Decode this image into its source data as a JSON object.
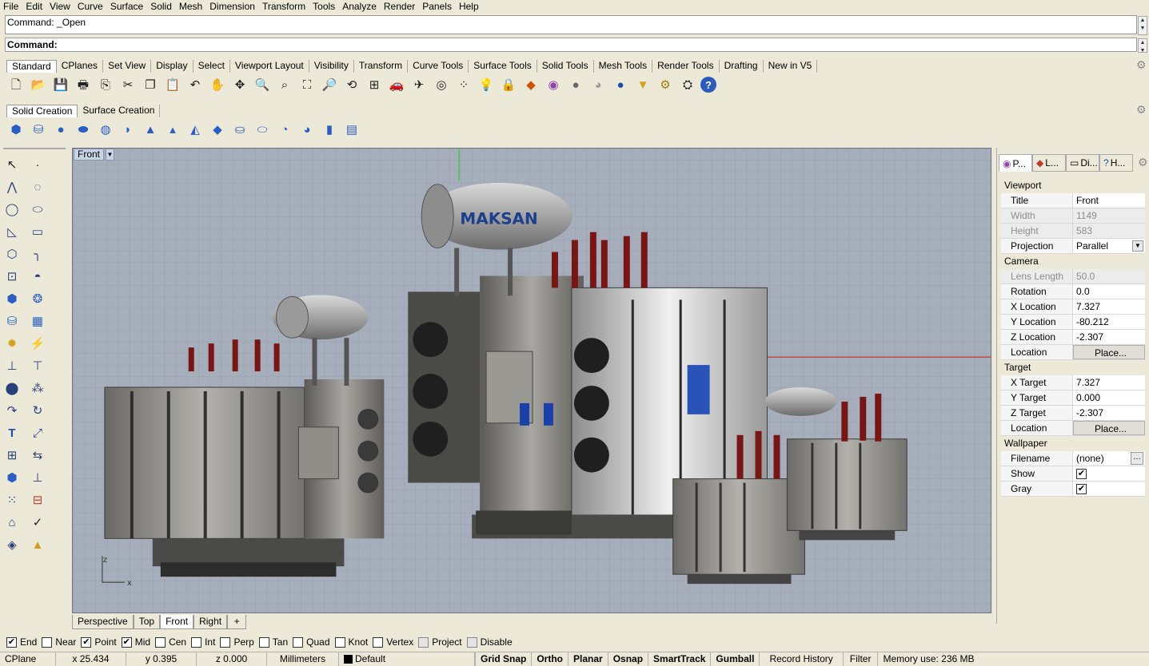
{
  "menu": [
    "File",
    "Edit",
    "View",
    "Curve",
    "Surface",
    "Solid",
    "Mesh",
    "Dimension",
    "Transform",
    "Tools",
    "Analyze",
    "Render",
    "Panels",
    "Help"
  ],
  "command": {
    "history": "Command: _Open",
    "prompt": "Command:"
  },
  "toolbar_tabs": [
    "Standard",
    "CPlanes",
    "Set View",
    "Display",
    "Select",
    "Viewport Layout",
    "Visibility",
    "Transform",
    "Curve Tools",
    "Surface Tools",
    "Solid Tools",
    "Mesh Tools",
    "Render Tools",
    "Drafting",
    "New in V5"
  ],
  "standard_icons": [
    "new-icon",
    "open-icon",
    "save-icon",
    "print-icon",
    "import-icon",
    "cut-icon",
    "copy-icon",
    "paste-icon",
    "undo-icon",
    "pan-icon",
    "rotate-view-icon",
    "zoom-icon",
    "zoom-window-icon",
    "zoom-extents-icon",
    "zoom-selected-icon",
    "rotate-icon",
    "four-views-icon",
    "car-icon",
    "plane-icon",
    "circle-target-icon",
    "point-grid-icon",
    "light-bulb-icon",
    "lock-icon",
    "layer-icon",
    "color-wheel-icon",
    "sphere-gray-icon",
    "sphere-shaded-icon",
    "sphere-blue-icon",
    "light-icon",
    "gear-wheel-icon",
    "options-icon",
    "help-icon"
  ],
  "solid_tabs": [
    "Solid Creation",
    "Surface Creation"
  ],
  "solid_icons": [
    "box-icon",
    "cylinder-icon",
    "sphere-icon",
    "ellipsoid-icon",
    "torus-icon",
    "cone-icon",
    "truncated-cone-icon",
    "pyramid-icon",
    "truncated-pyramid-icon",
    "tube-icon",
    "pipe-icon",
    "torus-knot-icon",
    "ring-icon",
    "extrude-icon",
    "slab-icon"
  ],
  "viewport": {
    "title": "Front",
    "tabs": [
      "Perspective",
      "Top",
      "Front",
      "Right"
    ],
    "brand_text": "MAKSAN",
    "axis_z": "z",
    "axis_x": "x"
  },
  "panel_tabs": [
    "P...",
    "L...",
    "Di...",
    "H..."
  ],
  "properties": {
    "viewport_section": "Viewport",
    "camera_section": "Camera",
    "target_section": "Target",
    "wallpaper_section": "Wallpaper",
    "rows": {
      "title": {
        "label": "Title",
        "value": "Front"
      },
      "width": {
        "label": "Width",
        "value": "1149"
      },
      "height": {
        "label": "Height",
        "value": "583"
      },
      "projection": {
        "label": "Projection",
        "value": "Parallel"
      },
      "lens": {
        "label": "Lens Length",
        "value": "50.0"
      },
      "rotation": {
        "label": "Rotation",
        "value": "0.0"
      },
      "xloc": {
        "label": "X Location",
        "value": "7.327"
      },
      "yloc": {
        "label": "Y Location",
        "value": "-80.212"
      },
      "zloc": {
        "label": "Z Location",
        "value": "-2.307"
      },
      "cam_location": {
        "label": "Location",
        "value": "Place..."
      },
      "xtarget": {
        "label": "X Target",
        "value": "7.327"
      },
      "ytarget": {
        "label": "Y Target",
        "value": "0.000"
      },
      "ztarget": {
        "label": "Z Target",
        "value": "-2.307"
      },
      "tgt_location": {
        "label": "Location",
        "value": "Place..."
      },
      "filename": {
        "label": "Filename",
        "value": "(none)"
      },
      "show": {
        "label": "Show",
        "checked": true
      },
      "gray": {
        "label": "Gray",
        "checked": true
      }
    }
  },
  "osnaps": [
    {
      "label": "End",
      "checked": true
    },
    {
      "label": "Near",
      "checked": false
    },
    {
      "label": "Point",
      "checked": true
    },
    {
      "label": "Mid",
      "checked": true
    },
    {
      "label": "Cen",
      "checked": false
    },
    {
      "label": "Int",
      "checked": false
    },
    {
      "label": "Perp",
      "checked": false
    },
    {
      "label": "Tan",
      "checked": false
    },
    {
      "label": "Quad",
      "checked": false
    },
    {
      "label": "Knot",
      "checked": false
    },
    {
      "label": "Vertex",
      "checked": false
    },
    {
      "label": "Project",
      "checked": false
    },
    {
      "label": "Disable",
      "checked": false
    }
  ],
  "status": {
    "cplane": "CPlane",
    "x": "x 25.434",
    "y": "y 0.395",
    "z": "z 0.000",
    "units": "Millimeters",
    "layer": "Default",
    "grid_snap": "Grid Snap",
    "ortho": "Ortho",
    "planar": "Planar",
    "osnap": "Osnap",
    "smarttrack": "SmartTrack",
    "gumball": "Gumball",
    "record_history": "Record History",
    "filter": "Filter",
    "memory": "Memory use: 236 MB"
  }
}
